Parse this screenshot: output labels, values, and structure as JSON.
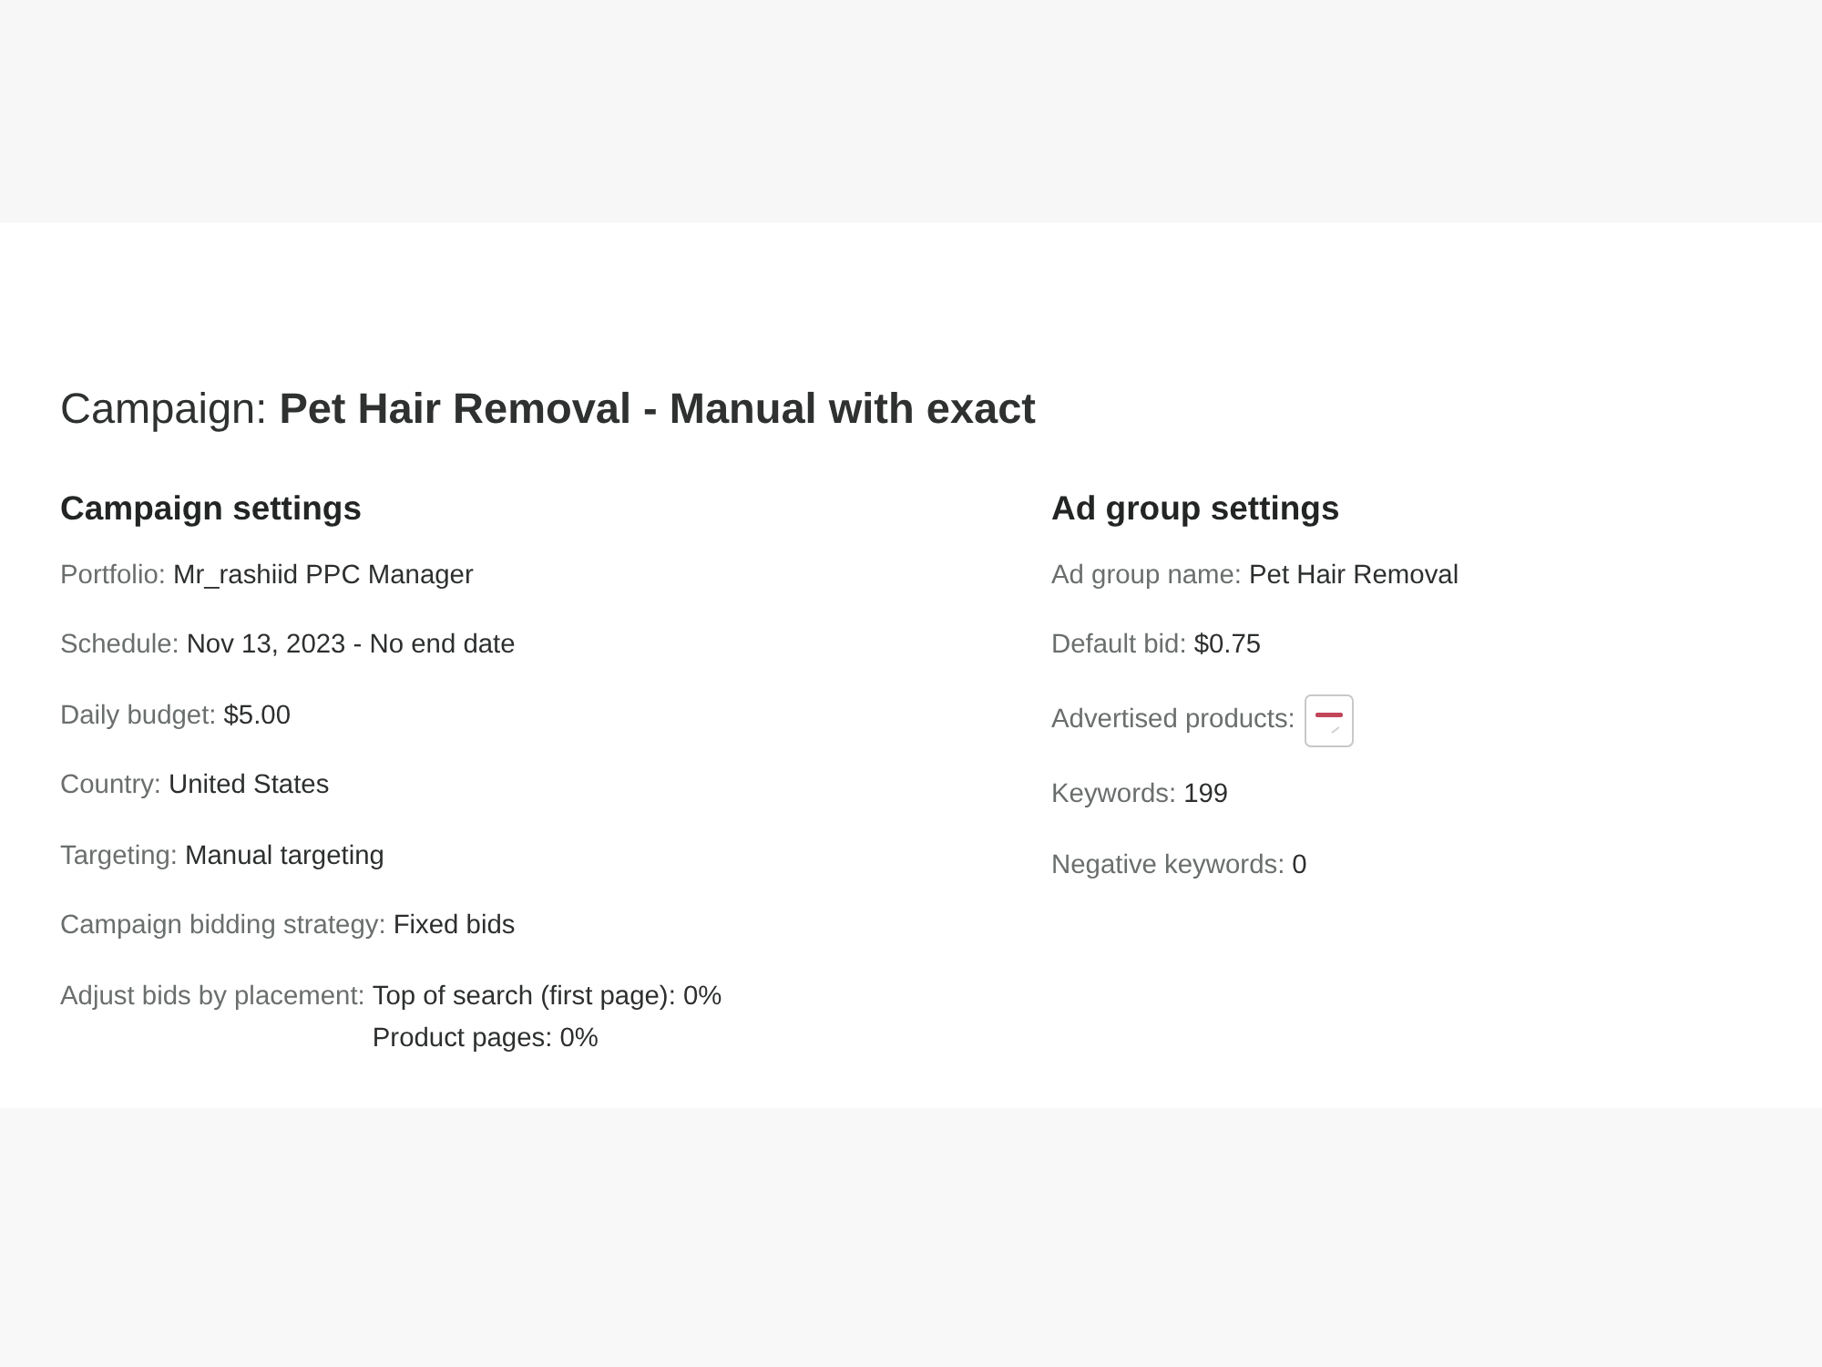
{
  "title": "Campaign: **Pet Hair Removal - Manual with exact**",
  "campaign_settings": {
    "heading": "Campaign settings",
    "fields": [
      {
        "kind": "text",
        "label": "Portfolio:",
        "value": "Mr_rashiid PPC Manager"
      },
      {
        "kind": "text",
        "label": "Schedule:",
        "value": "Nov 13, 2023 - No end date"
      },
      {
        "kind": "text",
        "label": "Daily budget:",
        "value": "$5.00"
      },
      {
        "kind": "text",
        "label": "Country:",
        "value": "United States"
      },
      {
        "kind": "text",
        "label": "Targeting:",
        "value": "Manual targeting"
      },
      {
        "kind": "text",
        "label": "Campaign bidding strategy:",
        "value": "Fixed bids"
      },
      {
        "kind": "lines",
        "label": "Adjust bids by placement:",
        "values": [
          "Top of search (first page): 0%",
          "Product pages: 0%"
        ]
      }
    ]
  },
  "ad_group_settings": {
    "heading": "Ad group settings",
    "fields": [
      {
        "kind": "text",
        "label": "Ad group name:",
        "value": "Pet Hair Removal"
      },
      {
        "kind": "text",
        "label": "Default bid:",
        "value": "$0.75"
      },
      {
        "kind": "image",
        "label": "Advertised products:"
      },
      {
        "kind": "text",
        "label": "Keywords:",
        "value": "199"
      },
      {
        "kind": "text",
        "label": "Negative keywords:",
        "value": "0"
      }
    ]
  }
}
